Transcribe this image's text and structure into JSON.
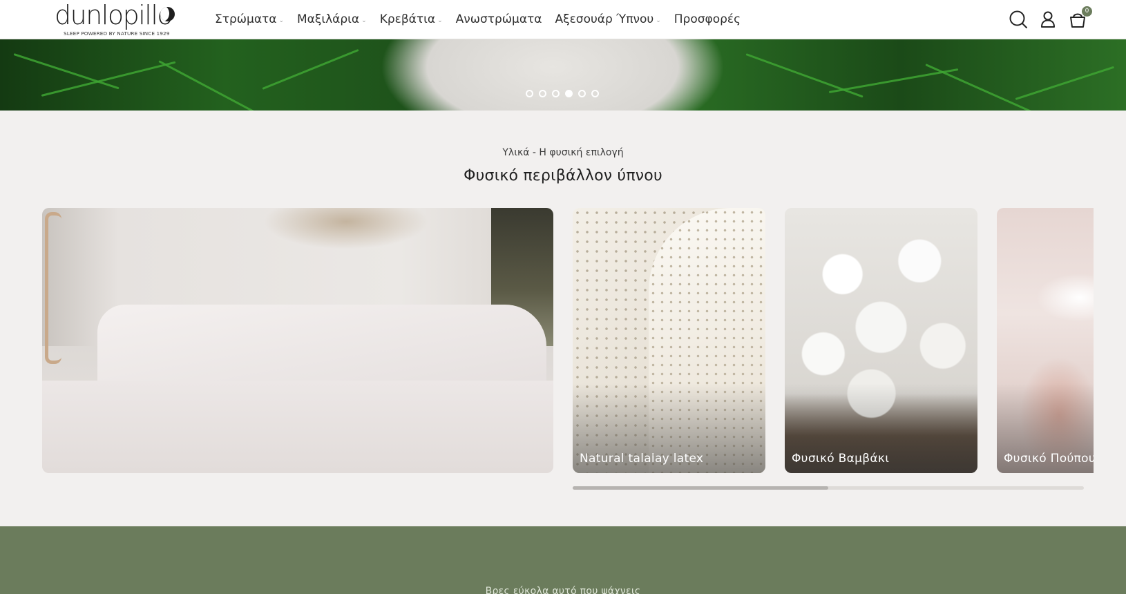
{
  "header": {
    "logo_text": "dunlopillo",
    "logo_tagline": "SLEEP POWERED BY NATURE SINCE 1929",
    "nav": [
      {
        "label": "Στρώματα",
        "has_dropdown": true
      },
      {
        "label": "Μαξιλάρια",
        "has_dropdown": true
      },
      {
        "label": "Κρεβάτια",
        "has_dropdown": true
      },
      {
        "label": "Ανωστρώματα",
        "has_dropdown": false
      },
      {
        "label": "Αξεσουάρ Ύπνου",
        "has_dropdown": true
      },
      {
        "label": "Προσφορές",
        "has_dropdown": false
      }
    ],
    "icons": [
      "search-icon",
      "account-icon",
      "cart-icon"
    ],
    "cart_count": "0"
  },
  "hero": {
    "slide_count": 6,
    "active_slide": 4
  },
  "materials": {
    "subtitle": "Υλικά - Η φυσική επιλογή",
    "title": "Φυσικό περιβάλλον ύπνου",
    "cards": [
      {
        "label": "Natural talalay latex"
      },
      {
        "label": "Φυσικό Βαμβάκι"
      },
      {
        "label": "Φυσικό Πούπουλο"
      }
    ],
    "scroll_progress": 0.5
  },
  "band": {
    "text": "Βρες εύκολα αυτό που ψάχνεις"
  },
  "colors": {
    "accent_green": "#6b7c5c",
    "background": "#f2f0ef"
  }
}
